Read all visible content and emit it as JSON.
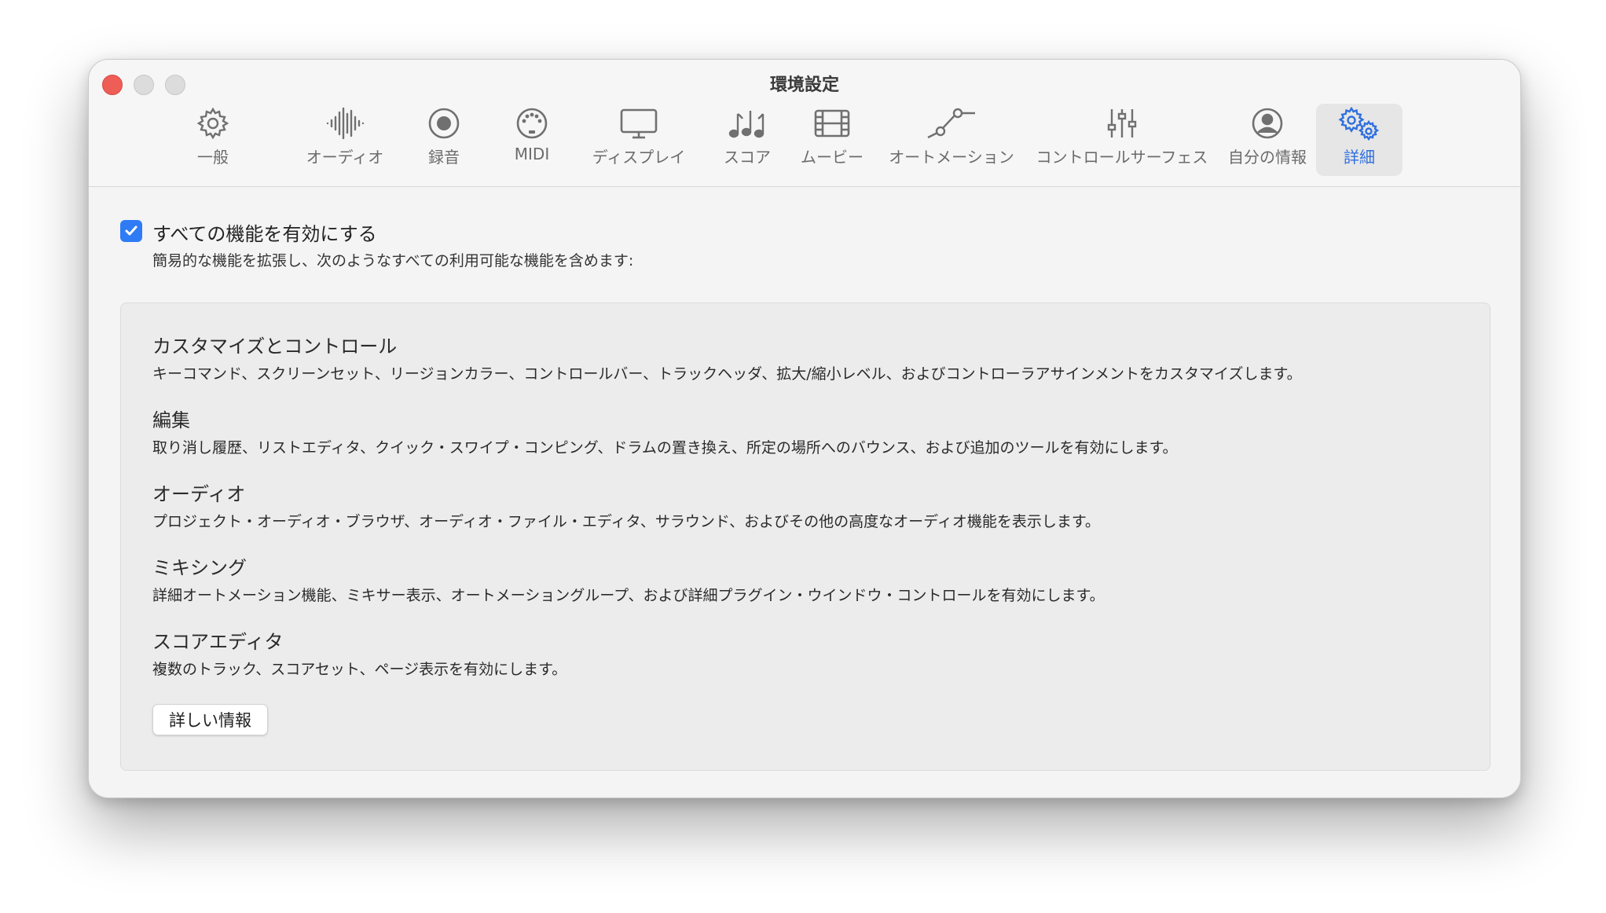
{
  "window": {
    "title": "環境設定"
  },
  "toolbar": {
    "items": [
      {
        "label": "一般",
        "icon": "gear-icon"
      },
      {
        "label": "オーディオ",
        "icon": "waveform-icon"
      },
      {
        "label": "録音",
        "icon": "record-icon"
      },
      {
        "label": "MIDI",
        "icon": "midi-port-icon"
      },
      {
        "label": "ディスプレイ",
        "icon": "display-icon"
      },
      {
        "label": "スコア",
        "icon": "music-notes-icon"
      },
      {
        "label": "ムービー",
        "icon": "film-icon"
      },
      {
        "label": "オートメーション",
        "icon": "automation-icon"
      },
      {
        "label": "コントロールサーフェス",
        "icon": "sliders-icon"
      },
      {
        "label": "自分の情報",
        "icon": "person-icon"
      },
      {
        "label": "詳細",
        "icon": "gears-icon",
        "selected": true
      }
    ]
  },
  "main": {
    "enable_all": {
      "checked": true,
      "label": "すべての機能を有効にする",
      "description": "簡易的な機能を拡張し、次のようなすべての利用可能な機能を含めます:"
    },
    "features": [
      {
        "title": "カスタマイズとコントロール",
        "description": "キーコマンド、スクリーンセット、リージョンカラー、コントロールバー、トラックヘッダ、拡大/縮小レベル、およびコントローラアサインメントをカスタマイズします。"
      },
      {
        "title": "編集",
        "description": "取り消し履歴、リストエディタ、クイック・スワイプ・コンピング、ドラムの置き換え、所定の場所へのバウンス、および追加のツールを有効にします。"
      },
      {
        "title": "オーディオ",
        "description": "プロジェクト・オーディオ・ブラウザ、オーディオ・ファイル・エディタ、サラウンド、およびその他の高度なオーディオ機能を表示します。"
      },
      {
        "title": "ミキシング",
        "description": "詳細オートメーション機能、ミキサー表示、オートメーショングループ、および詳細プラグイン・ウインドウ・コントロールを有効にします。"
      },
      {
        "title": "スコアエディタ",
        "description": "複数のトラック、スコアセット、ページ表示を有効にします。"
      }
    ],
    "more_info_label": "詳しい情報"
  },
  "colors": {
    "accent": "#2f7bf6",
    "selected_label": "#2f6fe0",
    "close": "#ee5e57"
  }
}
